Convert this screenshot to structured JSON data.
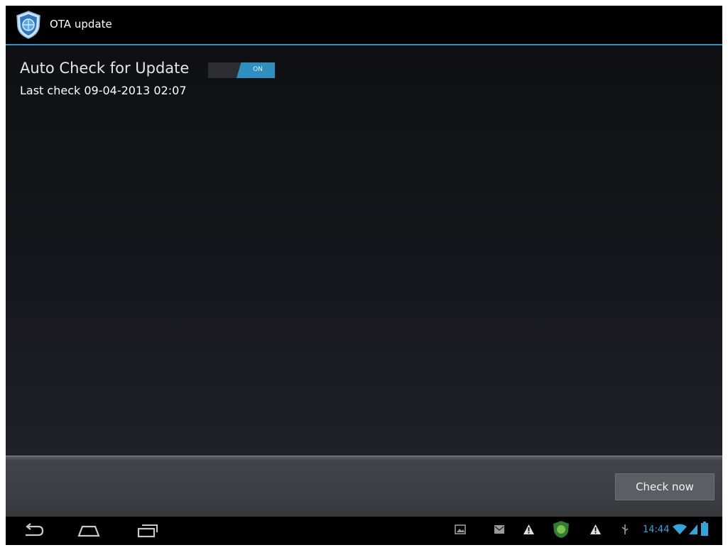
{
  "actionbar": {
    "app_icon": "ota-shield-icon",
    "title": "OTA update"
  },
  "preference": {
    "title": "Auto Check for Update",
    "summary": "Last check 09-04-2013 02:07",
    "switch_state": "ON"
  },
  "buttons": {
    "check_now": "Check now"
  },
  "navbar": {
    "back_icon": "back-icon",
    "home_icon": "home-icon",
    "recents_icon": "recent-apps-icon"
  },
  "statusbar": {
    "icons": [
      "gallery-notification-icon",
      "email-notification-icon",
      "warning-icon",
      "android-app-icon",
      "warning-icon",
      "usb-icon"
    ],
    "time": "14:44",
    "wifi_icon": "wifi-icon",
    "signal_icon": "signal-icon",
    "battery_icon": "battery-icon"
  },
  "colors": {
    "accent": "#2e8fc1",
    "clock": "#29a8e0"
  }
}
